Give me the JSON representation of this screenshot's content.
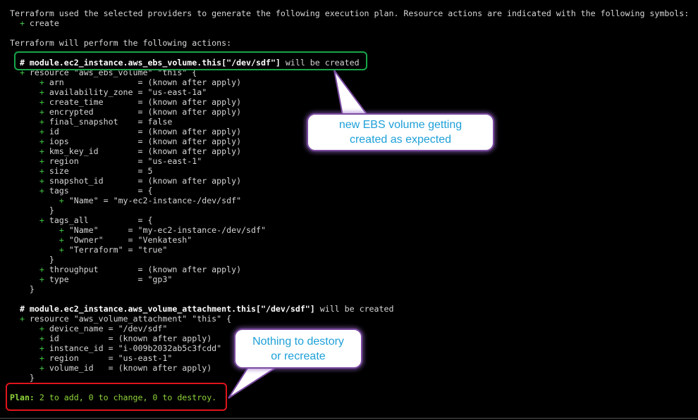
{
  "terminal": {
    "lines": [
      {
        "parts": [
          {
            "t": "Terraform used the selected providers to generate the following execution plan. Resource actions are indicated with the following symbols:",
            "c": ""
          }
        ]
      },
      {
        "parts": [
          {
            "t": "  + ",
            "c": "green"
          },
          {
            "t": "create",
            "c": ""
          }
        ]
      },
      {
        "parts": [
          {
            "t": "",
            "c": ""
          }
        ]
      },
      {
        "parts": [
          {
            "t": "Terraform will perform the following actions:",
            "c": ""
          }
        ]
      },
      {
        "parts": [
          {
            "t": "",
            "c": ""
          }
        ]
      },
      {
        "parts": [
          {
            "t": "  # module.ec2_instance.aws_ebs_volume.this[\"/dev/sdf\"]",
            "c": "bold"
          },
          {
            "t": " will be created",
            "c": ""
          }
        ]
      },
      {
        "parts": [
          {
            "t": "  + ",
            "c": "green"
          },
          {
            "t": "resource \"aws_ebs_volume\" \"this\" {",
            "c": ""
          }
        ]
      },
      {
        "parts": [
          {
            "t": "      + ",
            "c": "green"
          },
          {
            "t": "arn               = (known after apply)",
            "c": ""
          }
        ]
      },
      {
        "parts": [
          {
            "t": "      + ",
            "c": "green"
          },
          {
            "t": "availability_zone = \"us-east-1a\"",
            "c": ""
          }
        ]
      },
      {
        "parts": [
          {
            "t": "      + ",
            "c": "green"
          },
          {
            "t": "create_time       = (known after apply)",
            "c": ""
          }
        ]
      },
      {
        "parts": [
          {
            "t": "      + ",
            "c": "green"
          },
          {
            "t": "encrypted         = (known after apply)",
            "c": ""
          }
        ]
      },
      {
        "parts": [
          {
            "t": "      + ",
            "c": "green"
          },
          {
            "t": "final_snapshot    = false",
            "c": ""
          }
        ]
      },
      {
        "parts": [
          {
            "t": "      + ",
            "c": "green"
          },
          {
            "t": "id                = (known after apply)",
            "c": ""
          }
        ]
      },
      {
        "parts": [
          {
            "t": "      + ",
            "c": "green"
          },
          {
            "t": "iops              = (known after apply)",
            "c": ""
          }
        ]
      },
      {
        "parts": [
          {
            "t": "      + ",
            "c": "green"
          },
          {
            "t": "kms_key_id        = (known after apply)",
            "c": ""
          }
        ]
      },
      {
        "parts": [
          {
            "t": "      + ",
            "c": "green"
          },
          {
            "t": "region            = \"us-east-1\"",
            "c": ""
          }
        ]
      },
      {
        "parts": [
          {
            "t": "      + ",
            "c": "green"
          },
          {
            "t": "size              = 5",
            "c": ""
          }
        ]
      },
      {
        "parts": [
          {
            "t": "      + ",
            "c": "green"
          },
          {
            "t": "snapshot_id       = (known after apply)",
            "c": ""
          }
        ]
      },
      {
        "parts": [
          {
            "t": "      + ",
            "c": "green"
          },
          {
            "t": "tags              = {",
            "c": ""
          }
        ]
      },
      {
        "parts": [
          {
            "t": "          + ",
            "c": "green"
          },
          {
            "t": "\"Name\" = \"my-ec2-instance-/dev/sdf\"",
            "c": ""
          }
        ]
      },
      {
        "parts": [
          {
            "t": "        }",
            "c": ""
          }
        ]
      },
      {
        "parts": [
          {
            "t": "      + ",
            "c": "green"
          },
          {
            "t": "tags_all          = {",
            "c": ""
          }
        ]
      },
      {
        "parts": [
          {
            "t": "          + ",
            "c": "green"
          },
          {
            "t": "\"Name\"      = \"my-ec2-instance-/dev/sdf\"",
            "c": ""
          }
        ]
      },
      {
        "parts": [
          {
            "t": "          + ",
            "c": "green"
          },
          {
            "t": "\"Owner\"     = \"Venkatesh\"",
            "c": ""
          }
        ]
      },
      {
        "parts": [
          {
            "t": "          + ",
            "c": "green"
          },
          {
            "t": "\"Terraform\" = \"true\"",
            "c": ""
          }
        ]
      },
      {
        "parts": [
          {
            "t": "        }",
            "c": ""
          }
        ]
      },
      {
        "parts": [
          {
            "t": "      + ",
            "c": "green"
          },
          {
            "t": "throughput        = (known after apply)",
            "c": ""
          }
        ]
      },
      {
        "parts": [
          {
            "t": "      + ",
            "c": "green"
          },
          {
            "t": "type              = \"gp3\"",
            "c": ""
          }
        ]
      },
      {
        "parts": [
          {
            "t": "    }",
            "c": ""
          }
        ]
      },
      {
        "parts": [
          {
            "t": "",
            "c": ""
          }
        ]
      },
      {
        "parts": [
          {
            "t": "  # module.ec2_instance.aws_volume_attachment.this[\"/dev/sdf\"]",
            "c": "bold"
          },
          {
            "t": " will be created",
            "c": ""
          }
        ]
      },
      {
        "parts": [
          {
            "t": "  + ",
            "c": "green"
          },
          {
            "t": "resource \"aws_volume_attachment\" \"this\" {",
            "c": ""
          }
        ]
      },
      {
        "parts": [
          {
            "t": "      + ",
            "c": "green"
          },
          {
            "t": "device_name = \"/dev/sdf\"",
            "c": ""
          }
        ]
      },
      {
        "parts": [
          {
            "t": "      + ",
            "c": "green"
          },
          {
            "t": "id          = (known after apply)",
            "c": ""
          }
        ]
      },
      {
        "parts": [
          {
            "t": "      + ",
            "c": "green"
          },
          {
            "t": "instance_id = \"i-009b2032ab5c3fcdd\"",
            "c": ""
          }
        ]
      },
      {
        "parts": [
          {
            "t": "      + ",
            "c": "green"
          },
          {
            "t": "region      = \"us-east-1\"",
            "c": ""
          }
        ]
      },
      {
        "parts": [
          {
            "t": "      + ",
            "c": "green"
          },
          {
            "t": "volume_id   = (known after apply)",
            "c": ""
          }
        ]
      },
      {
        "parts": [
          {
            "t": "    }",
            "c": ""
          }
        ]
      },
      {
        "parts": [
          {
            "t": "",
            "c": ""
          }
        ]
      },
      {
        "parts": [
          {
            "t": "Plan:",
            "c": "plan-bold"
          },
          {
            "t": " 2 to add, 0 to change, 0 to destroy.",
            "c": "plan-text"
          }
        ]
      }
    ]
  },
  "callouts": {
    "ebs": {
      "line1": "new EBS volume getting",
      "line2": "created as expected"
    },
    "nothing": {
      "line1": "Nothing to destory",
      "line2": "or recreate"
    }
  },
  "colors": {
    "background": "#000000",
    "text": "#d6d6d6",
    "plus": "#3fc03f",
    "plan": "#8fd43a",
    "highlight_box": "#18a64a",
    "plan_box": "#e0141b",
    "callout_text": "#1ea0d8",
    "callout_border": "#7a4aa0"
  }
}
